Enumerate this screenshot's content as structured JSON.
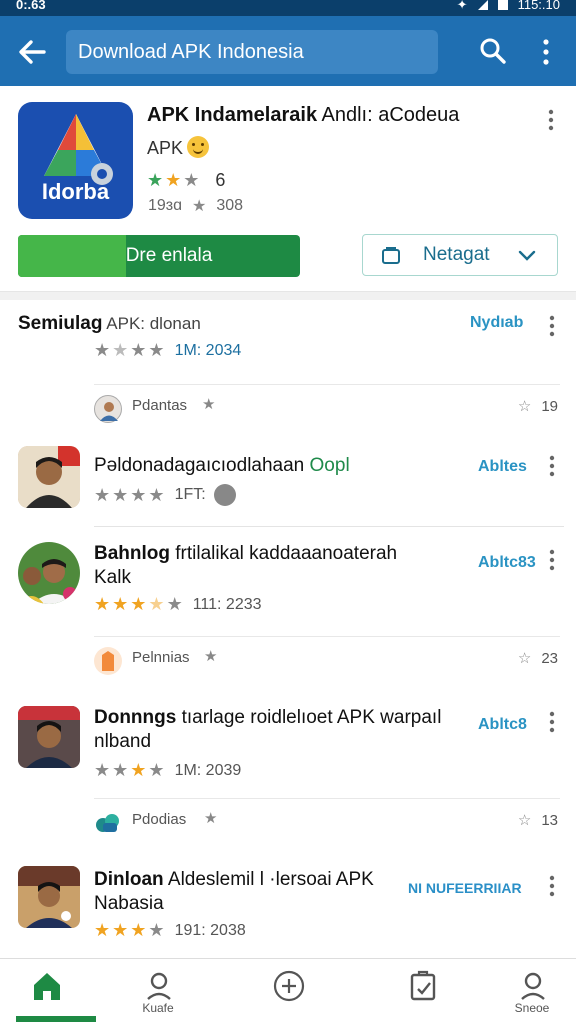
{
  "status_bar": {
    "time": "0:.63",
    "right": "115:.10"
  },
  "app_bar": {
    "search_text": "Download APK Indonesia",
    "icons": [
      "back-arrow-icon",
      "search-icon",
      "more-vert-icon"
    ]
  },
  "featured": {
    "title_bold": "APK Indamelaraik",
    "title_rest": " Andlı: aCodeua",
    "subtitle": "APK",
    "rating_count": "6",
    "meta_left": "19ɜɑ",
    "meta_right": "308",
    "icon_label": "Idorba",
    "download_label": "Dre enlala",
    "notify_label": "Netagat"
  },
  "list": [
    {
      "title": "Semiulag",
      "title_rest": " APK: dlonan",
      "action": "Nydıab",
      "rating_meta": "1M: 2034"
    },
    {
      "title": "Pəldonadagaıcıodlahaan",
      "title_green": " Oopl",
      "action": "Abltes",
      "rating_meta": "1FT:"
    },
    {
      "title": "Bahnlog",
      "title_rest": " frtilalikal kaddaaanoaterah",
      "line2": "Kalk",
      "action": "Abltc83",
      "rating_meta": "111: 2233"
    },
    {
      "title": "Donnngs",
      "title_rest": " tıarlage roidlelıoet APK warpaıl",
      "line2": "nlband",
      "action": "Abltc8",
      "rating_meta": "1M: 2039"
    },
    {
      "title": "Dinloan",
      "title_rest": " Aldeslemil l ·lersoai APK",
      "line2": "Nabasia",
      "action": "NI NUFEERRIIAR",
      "rating_meta": "191: 2038"
    }
  ],
  "sub_rows": [
    {
      "who": "Pdantas",
      "count": "19"
    },
    {
      "who": "Pelnnias",
      "count": "23"
    },
    {
      "who": "Pdodias",
      "count": "13"
    }
  ],
  "bottom_nav": [
    {
      "label": "",
      "icon": "home-icon"
    },
    {
      "label": "Kuafe",
      "icon": "profile-icon"
    },
    {
      "label": "",
      "icon": "add-circle-icon"
    },
    {
      "label": "",
      "icon": "clipboard-icon"
    },
    {
      "label": "Sneoe",
      "icon": "user-icon"
    }
  ],
  "colors": {
    "app_bar": "#1f6fb2",
    "download_green": "#1e8a44",
    "accent_blue": "#2a93c3",
    "star": "#f0a321"
  }
}
